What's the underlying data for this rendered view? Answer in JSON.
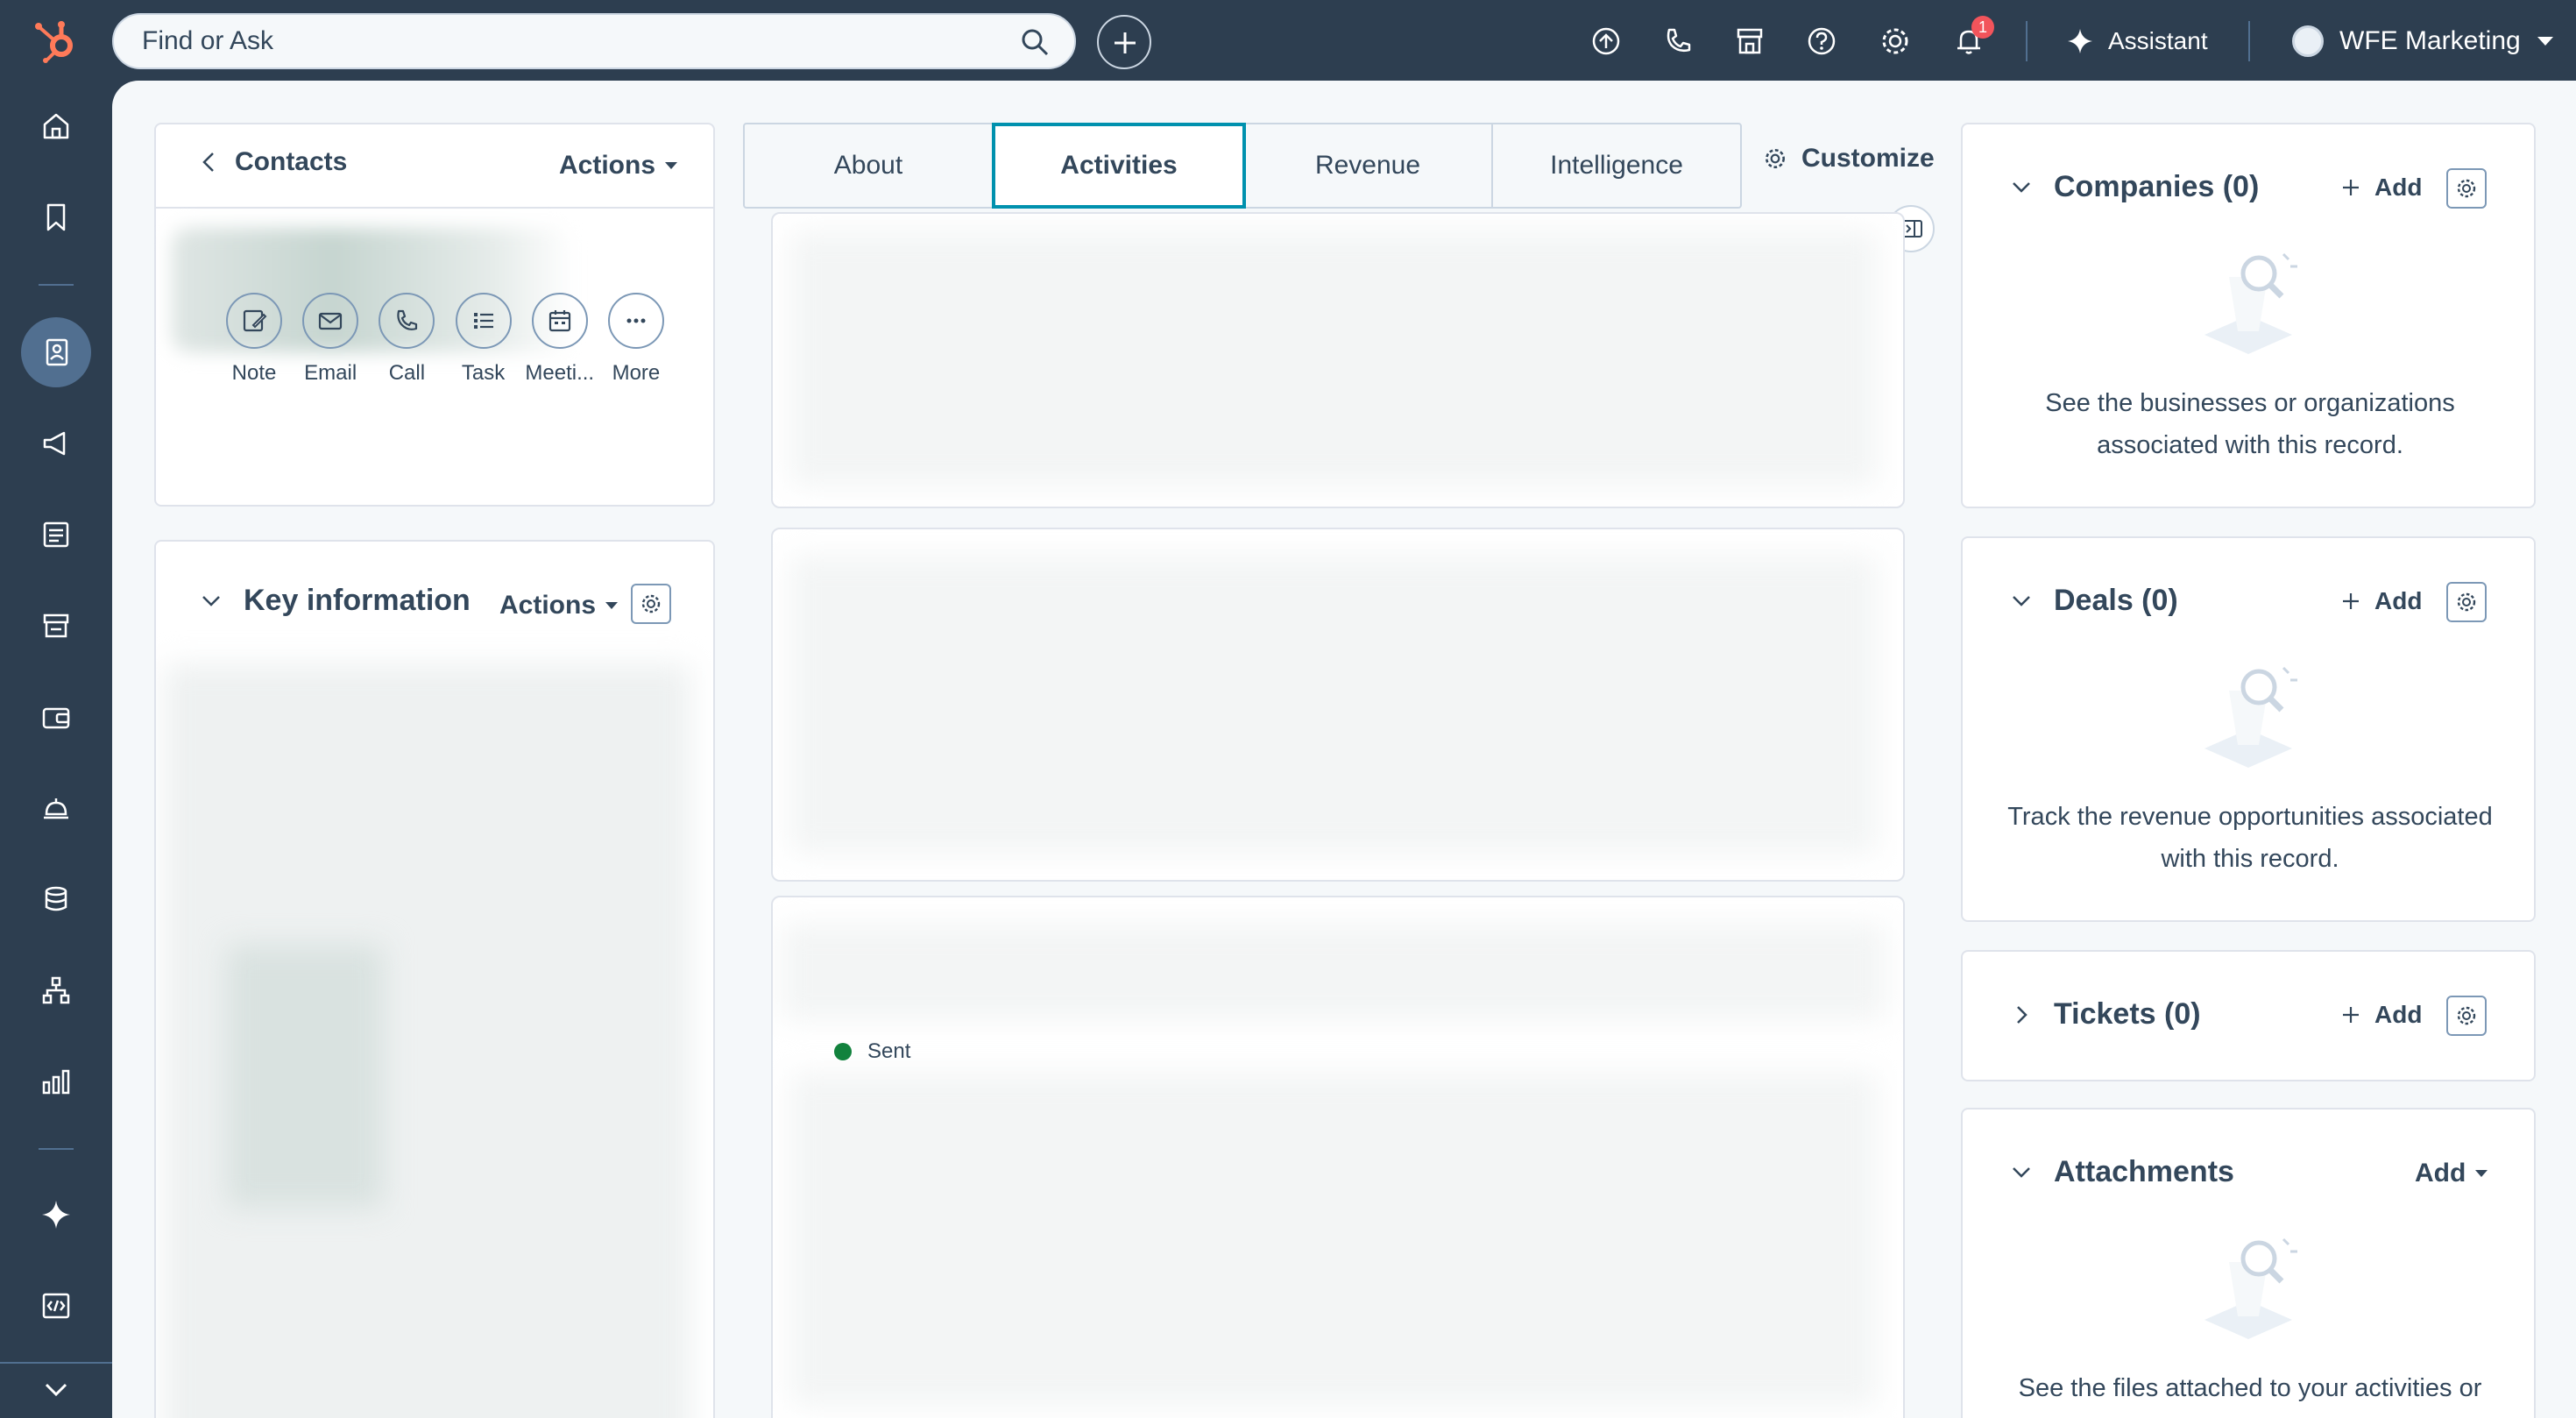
{
  "search": {
    "placeholder": "Find or Ask"
  },
  "topbar": {
    "assistant_label": "Assistant",
    "account_name": "WFE Marketing",
    "notification_count": "1"
  },
  "contacts_card": {
    "back_label": "Contacts",
    "actions_label": "Actions"
  },
  "quick_actions": [
    "Note",
    "Email",
    "Call",
    "Task",
    "Meeti...",
    "More"
  ],
  "key_info": {
    "title": "Key information",
    "actions_label": "Actions"
  },
  "tabs": [
    "About",
    "Activities",
    "Revenue",
    "Intelligence"
  ],
  "active_tab": "Activities",
  "customize_label": "Customize",
  "activity": {
    "status": "Sent"
  },
  "companies": {
    "title": "Companies (0)",
    "add_label": "Add",
    "empty_text": "See the businesses or organizations associated with this record."
  },
  "deals": {
    "title": "Deals (0)",
    "add_label": "Add",
    "empty_text": "Track the revenue opportunities associated with this record."
  },
  "tickets": {
    "title": "Tickets (0)",
    "add_label": "Add"
  },
  "attachments": {
    "title": "Attachments",
    "add_label": "Add",
    "empty_text": "See the files attached to your activities or"
  },
  "colors": {
    "brand": "#ff7a59",
    "nav_bg": "#2d3e50",
    "active_tab_border": "#0091ae",
    "badge": "#f2545b",
    "sent": "#12823d"
  },
  "icons": [
    "hubspot-logo-icon",
    "search-icon",
    "plus-icon",
    "upgrade-icon",
    "phone-icon",
    "marketplace-icon",
    "help-icon",
    "settings-icon",
    "bell-icon",
    "sparkle-icon",
    "chevron-down-icon"
  ]
}
